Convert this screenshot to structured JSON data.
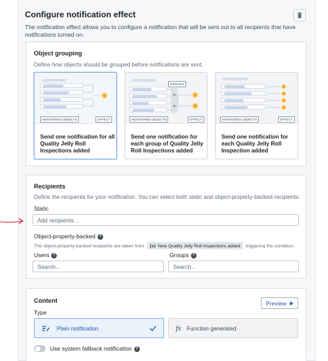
{
  "header": {
    "title": "Configure notification effect",
    "description": "The notification effect allows you to configure a notification that will be sent out to all recipients that have notifications turned on."
  },
  "grouping": {
    "title": "Object grouping",
    "subtitle": "Define how objects should be grouped before notifications are sent.",
    "options": [
      {
        "label": "Send one notification for all Quality Jelly Roll Inspections added",
        "selected": true
      },
      {
        "label": "Send one notification for each group of Quality Jelly Roll Inspections added",
        "selected": false
      },
      {
        "label": "Send one notification for each Quality Jelly Roll Inspection added",
        "selected": false
      }
    ],
    "illus": {
      "monitored": "MONITORED OBJECTS",
      "effect": "EFFECT",
      "groups": "GROUPS"
    }
  },
  "recipients": {
    "title": "Recipients",
    "subtitle": "Define the recipients for your notification. You can select both static and object-property-backed recipients.",
    "static_label": "Static",
    "static_placeholder": "Add recipients…",
    "op_label": "Object-property-backed",
    "op_desc_before": "The object-property backed recipients are taken from",
    "op_var_symbol": "(x)",
    "op_var_name": "New Quality Jelly Roll Inspections added",
    "op_desc_after": "triggering the condition.",
    "users_label": "Users",
    "users_placeholder": "Search...",
    "groups_label": "Groups",
    "groups_placeholder": "Search..."
  },
  "content": {
    "title": "Content",
    "preview_label": "Preview",
    "type_label": "Type",
    "type_options": [
      {
        "label": "Plain notification",
        "icon": "plain-notification-icon",
        "selected": true
      },
      {
        "label": "Function generated",
        "icon": "function-icon",
        "selected": false
      }
    ],
    "fallback_label": "Use system fallback notification",
    "fallback_enabled": false
  },
  "colors": {
    "accent": "#215db0",
    "selected_border": "#7fb0e6",
    "annotation_arrow": "#d0233a",
    "effect_orange": "#f0a830"
  }
}
